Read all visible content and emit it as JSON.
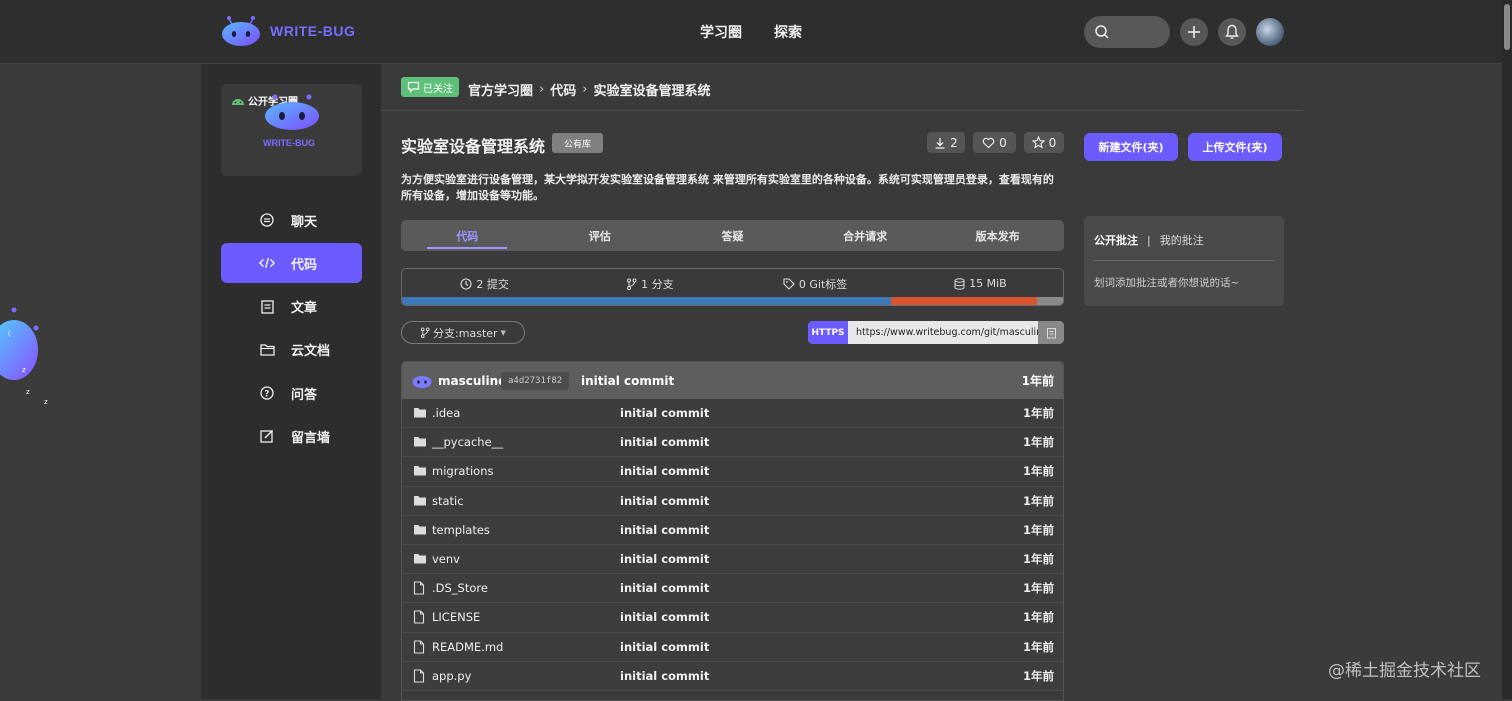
{
  "brand": {
    "name": "WRITE-BUG",
    "color": "#7b6cff"
  },
  "topnav": {
    "items": [
      "学习圈",
      "探索"
    ]
  },
  "header_icons": {
    "search": "search-icon",
    "add": "plus-icon",
    "notify": "bell-icon"
  },
  "circle": {
    "tag": "公开学习圈",
    "logo_text": "WRITE-BUG"
  },
  "sidebar": {
    "items": [
      {
        "label": "聊天",
        "icon": "chat-icon",
        "active": false
      },
      {
        "label": "代码",
        "icon": "code-icon",
        "active": true
      },
      {
        "label": "文章",
        "icon": "article-icon",
        "active": false
      },
      {
        "label": "云文档",
        "icon": "folder-icon",
        "active": false
      },
      {
        "label": "问答",
        "icon": "question-icon",
        "active": false
      },
      {
        "label": "留言墙",
        "icon": "edit-icon",
        "active": false
      }
    ]
  },
  "breadcrumb": {
    "follow_label": "已关注",
    "items": [
      "官方学习圈",
      "代码",
      "实验室设备管理系统"
    ]
  },
  "repo": {
    "title": "实验室设备管理系统",
    "badge": "公有库",
    "downloads": "2",
    "likes": "0",
    "stars": "0",
    "description": "为方便实验室进行设备管理，某大学拟开发实验室设备管理系统 来管理所有实验室里的各种设备。系统可实现管理员登录，查看现有的所有设备，增加设备等功能。"
  },
  "actions": {
    "new_file": "新建文件(夹)",
    "upload_file": "上传文件(夹)"
  },
  "tabs": [
    "代码",
    "评估",
    "答疑",
    "合并请求",
    "版本发布"
  ],
  "stats": {
    "commits": "2 提交",
    "branches": "1 分支",
    "tags": "0 Git标签",
    "size": "15 MiB"
  },
  "languages": [
    {
      "color": "#3d79b8",
      "percent": 74
    },
    {
      "color": "#d9542f",
      "percent": 22
    },
    {
      "color": "#8a8a8a",
      "percent": 4
    }
  ],
  "branch": {
    "label": "分支:master"
  },
  "clone": {
    "protocol": "HTTPS",
    "url": "https://www.writebug.com/git/masculine"
  },
  "last_commit": {
    "author": "masculine",
    "hash": "a4d2731f82",
    "message": "initial commit",
    "time": "1年前"
  },
  "files": [
    {
      "name": ".idea",
      "type": "folder",
      "message": "initial commit",
      "time": "1年前"
    },
    {
      "name": "__pycache__",
      "type": "folder",
      "message": "initial commit",
      "time": "1年前"
    },
    {
      "name": "migrations",
      "type": "folder",
      "message": "initial commit",
      "time": "1年前"
    },
    {
      "name": "static",
      "type": "folder",
      "message": "initial commit",
      "time": "1年前"
    },
    {
      "name": "templates",
      "type": "folder",
      "message": "initial commit",
      "time": "1年前"
    },
    {
      "name": "venv",
      "type": "folder",
      "message": "initial commit",
      "time": "1年前"
    },
    {
      "name": ".DS_Store",
      "type": "file",
      "message": "initial commit",
      "time": "1年前"
    },
    {
      "name": "LICENSE",
      "type": "file",
      "message": "initial commit",
      "time": "1年前"
    },
    {
      "name": "README.md",
      "type": "file",
      "message": "initial commit",
      "time": "1年前"
    },
    {
      "name": "app.py",
      "type": "file",
      "message": "initial commit",
      "time": "1年前"
    }
  ],
  "notes": {
    "tab_public": "公开批注",
    "separator": "|",
    "tab_mine": "我的批注",
    "hint": "划词添加批注或者你想说的话~"
  },
  "watermark": "@稀土掘金技术社区"
}
